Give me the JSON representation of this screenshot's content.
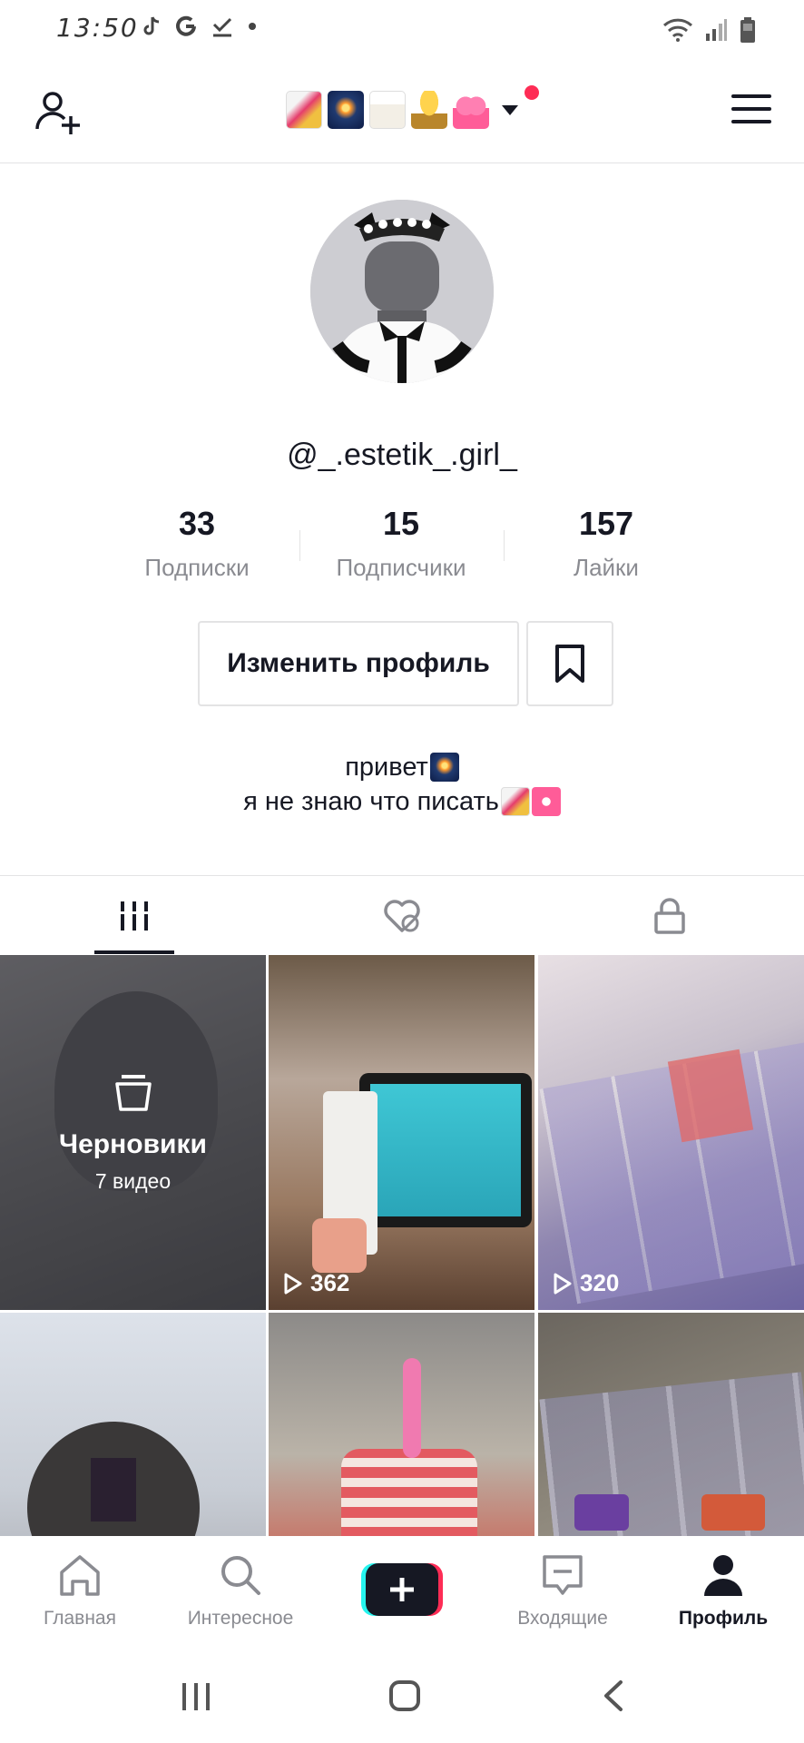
{
  "status_bar": {
    "time": "13:50",
    "left_icons": [
      "tiktok-icon",
      "google-icon",
      "check-download-icon",
      "dot-icon"
    ],
    "right_icons": [
      "wifi-icon",
      "signal-icon",
      "battery-icon"
    ]
  },
  "header": {
    "title_emojis": [
      "joker-card-emoji",
      "fireworks-emoji",
      "takeout-box-emoji",
      "trophy-emoji",
      "gift-heart-emoji"
    ],
    "has_notification": true
  },
  "profile": {
    "username": "@_.estetik_.girl_",
    "stats": [
      {
        "value": "33",
        "label": "Подписки"
      },
      {
        "value": "15",
        "label": "Подписчики"
      },
      {
        "value": "157",
        "label": "Лайки"
      }
    ],
    "edit_button": "Изменить профиль",
    "bio_line1": "привет",
    "bio_line2": "я не знаю что писать"
  },
  "tabs": [
    "videos-tab",
    "liked-tab",
    "private-tab"
  ],
  "grid": {
    "drafts_title": "Черновики",
    "drafts_count": "7 видео",
    "views": [
      "362",
      "320"
    ]
  },
  "bottom_nav": [
    {
      "label": "Главная",
      "icon": "home-icon",
      "active": false
    },
    {
      "label": "Интересное",
      "icon": "search-icon",
      "active": false
    },
    {
      "label": "",
      "icon": "create-icon",
      "active": false
    },
    {
      "label": "Входящие",
      "icon": "inbox-icon",
      "active": false
    },
    {
      "label": "Профиль",
      "icon": "profile-icon",
      "active": true
    }
  ],
  "colors": {
    "accent": "#fe2c55",
    "cyan": "#25f4ee",
    "text": "#161823",
    "muted": "#8a8b91"
  }
}
